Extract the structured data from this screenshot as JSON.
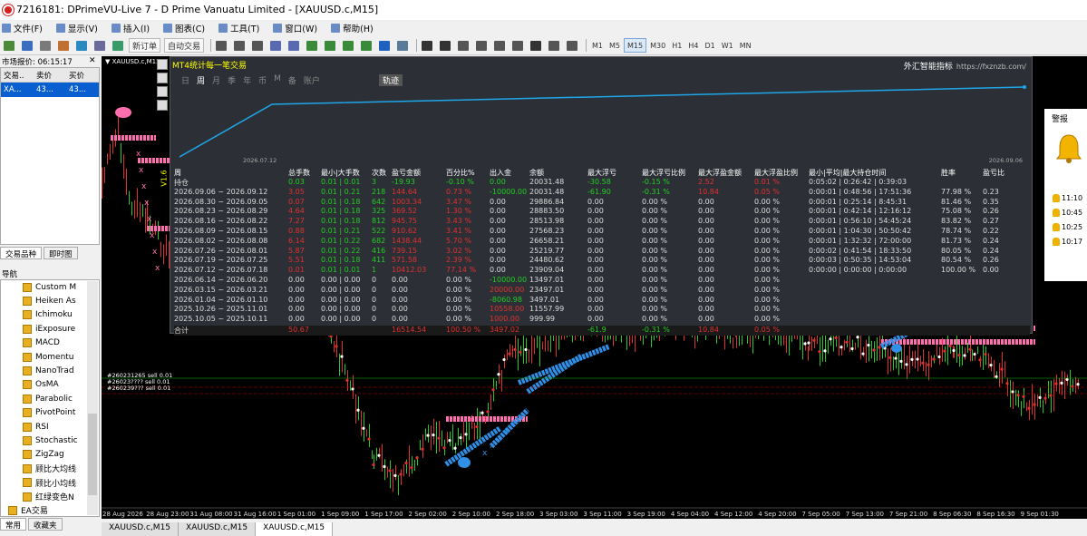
{
  "window": {
    "title": "7216181: DPrimeVU-Live 7 - D Prime Vanuatu Limited - [XAUUSD.c,M15]"
  },
  "menu": [
    "文件(F)",
    "显示(V)",
    "插入(I)",
    "图表(C)",
    "工具(T)",
    "窗口(W)",
    "帮助(H)"
  ],
  "toolbar": {
    "new_order": "新订单",
    "auto_trade": "自动交易",
    "timeframes": [
      "M1",
      "M5",
      "M15",
      "M30",
      "H1",
      "H4",
      "D1",
      "W1",
      "MN"
    ],
    "active_tf": "M15",
    "icons": [
      "new-chart-icon",
      "profiles-icon",
      "market-watch-icon",
      "navigator-icon",
      "data-window-icon",
      "terminal-icon",
      "tester-icon",
      "bar-chart-icon",
      "candles-icon",
      "line-chart-icon",
      "zoom-in-icon",
      "zoom-out-icon",
      "tile-icon",
      "autoscroll-icon",
      "chart-shift-icon",
      "indicators-icon",
      "periods-icon",
      "templates-icon",
      "cursor-icon",
      "crosshair-icon",
      "vline-icon",
      "hline-icon",
      "trendline-icon",
      "channel-icon",
      "text-icon",
      "label-icon",
      "arrows-icon"
    ]
  },
  "market_watch": {
    "title": "市场报价: 06:15:17",
    "headers": [
      "交易..",
      "卖价",
      "买价"
    ],
    "rows": [
      [
        "XA...",
        "43...",
        "43..."
      ]
    ],
    "tabs": [
      "交易品种",
      "即时图"
    ]
  },
  "navigator": {
    "title": "导航",
    "items": [
      "Custom M",
      "Heiken As",
      "Ichimoku",
      "iExposure",
      "MACD",
      "Momentu",
      "NanoTrad",
      "OsMA",
      "Parabolic",
      "PivotPoint",
      "RSI",
      "Stochastic",
      "ZigZag",
      "顾比大均线",
      "顾比小均线",
      "红绿变色N",
      "EA交易"
    ],
    "tabs": [
      "常用",
      "收藏夹"
    ]
  },
  "chart": {
    "title": "▼ XAUUSD.c,M15",
    "vlabel": "V1.6",
    "x_labels": [
      "28 Aug 2026",
      "28 Aug 23:00",
      "31 Aug 08:00",
      "31 Aug 16:00",
      "1 Sep 01:00",
      "1 Sep 09:00",
      "1 Sep 17:00",
      "2 Sep 02:00",
      "2 Sep 10:00",
      "2 Sep 18:00",
      "3 Sep 03:00",
      "3 Sep 11:00",
      "3 Sep 19:00",
      "4 Sep 04:00",
      "4 Sep 12:00",
      "4 Sep 20:00",
      "7 Sep 05:00",
      "7 Sep 13:00",
      "7 Sep 21:00",
      "8 Sep 06:30",
      "8 Sep 16:30",
      "9 Sep 01:30"
    ],
    "orders": [
      "#260231265 sell 0.01",
      "#26023???? sell 0.01",
      "#260239??? sell 0.01"
    ]
  },
  "stats_panel": {
    "title": "MT4统计每一笔交易",
    "brand": "外汇智能指标",
    "url": "https://fxznzb.com/",
    "tabs": [
      "年",
      "日",
      "周",
      "月",
      "季",
      "年",
      "币",
      "M",
      "备",
      "账户"
    ],
    "active_tab": "周",
    "track_label": "轨迹",
    "curve_start": "2026.07.12",
    "curve_end": "2026.09.06",
    "headers": [
      "周",
      "总手数",
      "最小|大手数",
      "次数",
      "盈亏金额",
      "百分比%",
      "出入金",
      "余额",
      "最大浮亏",
      "最大浮亏比例",
      "最大浮盈金额",
      "最大浮盈比例",
      "最小|平均|最大持仓时间",
      "胜率",
      "盈亏比"
    ],
    "rows": [
      [
        "持仓",
        "0.03",
        "0.01 | 0.01",
        "3",
        "-19.93",
        "-0.10 %",
        "0.00",
        "20031.48",
        "-30.58",
        "-0.15 %",
        "2.52",
        "0.01 %",
        "0:05:02 | 0:26:42 | 0:39:03",
        "",
        ""
      ],
      [
        "2026.09.06 ~ 2026.09.12",
        "3.05",
        "0.01 | 0.21",
        "218",
        "144.64",
        "0.73 %",
        "-10000.00",
        "20031.48",
        "-61.90",
        "-0.31 %",
        "10.84",
        "0.05 %",
        "0:00:01 | 0:48:56 | 17:51:36",
        "77.98 %",
        "0.23"
      ],
      [
        "2026.08.30 ~ 2026.09.05",
        "0.07",
        "0.01 | 0.18",
        "642",
        "1003.34",
        "3.47 %",
        "0.00",
        "29886.84",
        "0.00",
        "0.00 %",
        "0.00",
        "0.00 %",
        "0:00:01 | 0:25:14 | 8:45:31",
        "81.46 %",
        "0.35"
      ],
      [
        "2026.08.23 ~ 2026.08.29",
        "4.64",
        "0.01 | 0.18",
        "325",
        "369.52",
        "1.30 %",
        "0.00",
        "28883.50",
        "0.00",
        "0.00 %",
        "0.00",
        "0.00 %",
        "0:00:01 | 0:42:14 | 12:16:12",
        "75.08 %",
        "0.26"
      ],
      [
        "2026.08.16 ~ 2026.08.22",
        "7.27",
        "0.01 | 0.18",
        "812",
        "945.75",
        "3.43 %",
        "0.00",
        "28513.98",
        "0.00",
        "0.00 %",
        "0.00",
        "0.00 %",
        "0:00:01 | 0:56:10 | 54:45:24",
        "83.82 %",
        "0.27"
      ],
      [
        "2026.08.09 ~ 2026.08.15",
        "0.88",
        "0.01 | 0.21",
        "522",
        "910.62",
        "3.41 %",
        "0.00",
        "27568.23",
        "0.00",
        "0.00 %",
        "0.00",
        "0.00 %",
        "0:00:01 | 1:04:30 | 50:50:42",
        "78.74 %",
        "0.22"
      ],
      [
        "2026.08.02 ~ 2026.08.08",
        "6.14",
        "0.01 | 0.22",
        "682",
        "1438.44",
        "5.70 %",
        "0.00",
        "26658.21",
        "0.00",
        "0.00 %",
        "0.00",
        "0.00 %",
        "0:00:01 | 1:32:32 | 72:00:00",
        "81.73 %",
        "0.24"
      ],
      [
        "2026.07.26 ~ 2026.08.01",
        "5.87",
        "0.01 | 0.22",
        "416",
        "739.15",
        "3.02 %",
        "0.00",
        "25219.77",
        "0.00",
        "0.00 %",
        "0.00",
        "0.00 %",
        "0:00:02 | 0:41:54 | 18:33:50",
        "80.05 %",
        "0.24"
      ],
      [
        "2026.07.19 ~ 2026.07.25",
        "5.51",
        "0.01 | 0.18",
        "411",
        "571.58",
        "2.39 %",
        "0.00",
        "24480.62",
        "0.00",
        "0.00 %",
        "0.00",
        "0.00 %",
        "0:00:03 | 0:50:35 | 14:53:04",
        "80.54 %",
        "0.26"
      ],
      [
        "2026.07.12 ~ 2026.07.18",
        "0.01",
        "0.01 | 0.01",
        "1",
        "10412.03",
        "77.14 %",
        "0.00",
        "23909.04",
        "0.00",
        "0.00 %",
        "0.00",
        "0.00 %",
        "0:00:00 | 0:00:00 | 0:00:00",
        "100.00 %",
        "0.00"
      ],
      [
        "2026.06.14 ~ 2026.06.20",
        "0.00",
        "0.00 | 0.00",
        "0",
        "0.00",
        "0.00 %",
        "-10000.00",
        "13497.01",
        "0.00",
        "0.00 %",
        "0.00",
        "0.00 %",
        "",
        "",
        ""
      ],
      [
        "2026.03.15 ~ 2026.03.21",
        "0.00",
        "0.00 | 0.00",
        "0",
        "0.00",
        "0.00 %",
        "20000.00",
        "23497.01",
        "0.00",
        "0.00 %",
        "0.00",
        "0.00 %",
        "",
        "",
        ""
      ],
      [
        "2026.01.04 ~ 2026.01.10",
        "0.00",
        "0.00 | 0.00",
        "0",
        "0.00",
        "0.00 %",
        "-8060.98",
        "3497.01",
        "0.00",
        "0.00 %",
        "0.00",
        "0.00 %",
        "",
        "",
        ""
      ],
      [
        "2025.10.26 ~ 2025.11.01",
        "0.00",
        "0.00 | 0.00",
        "0",
        "0.00",
        "0.00 %",
        "10558.00",
        "11557.99",
        "0.00",
        "0.00 %",
        "0.00",
        "0.00 %",
        "",
        "",
        ""
      ],
      [
        "2025.10.05 ~ 2025.10.11",
        "0.00",
        "0.00 | 0.00",
        "0",
        "0.00",
        "0.00 %",
        "1000.00",
        "999.99",
        "0.00",
        "0.00 %",
        "0.00",
        "0.00 %",
        "",
        "",
        ""
      ]
    ],
    "total": [
      "合计",
      "50.67",
      "",
      "",
      "16514.54",
      "100.50 %",
      "3497.02",
      "",
      "-61.9",
      "-0.31 %",
      "10.84",
      "0.05 %",
      "",
      "",
      ""
    ]
  },
  "alerts": {
    "title": "警报",
    "items": [
      "11:10",
      "10:45",
      "10:25",
      "10:17"
    ]
  },
  "bottom_tabs": [
    "XAUUSD.c,M15",
    "XAUUSD.c,M15",
    "XAUUSD.c,M15"
  ],
  "colors": {
    "accent": "#0a5fd0",
    "panel_bg": "#2c3036",
    "curve": "#1ea6e8",
    "green": "#22cc22",
    "red": "#e03030",
    "pink": "#ff6fb0",
    "blue_marks": "#3090e8"
  }
}
